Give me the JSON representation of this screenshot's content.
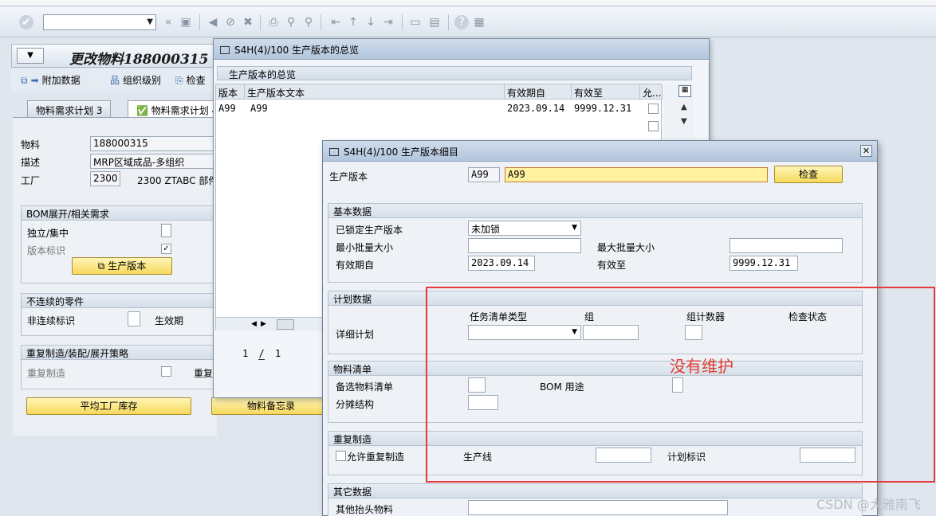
{
  "toolbar": {
    "command_field": "",
    "icons": [
      "enter-icon",
      "back-icon",
      "exit-icon",
      "cancel-icon",
      "save-icon",
      "print-icon",
      "find-icon",
      "find-next-icon",
      "first-page-icon",
      "prev-page-icon",
      "next-page-icon",
      "last-page-icon",
      "new-session-icon",
      "shortcut-icon",
      "help-icon",
      "layout-icon"
    ]
  },
  "main": {
    "title": "更改物料188000315",
    "app_toolbar": {
      "additional_data": "附加数据",
      "org_levels": "组织级别",
      "check": "检查"
    },
    "tabs": [
      {
        "label": "物料需求计划 3"
      },
      {
        "label": "物料需求计划 4"
      }
    ],
    "fields": {
      "material_label": "物料",
      "material_value": "188000315",
      "desc_label": "描述",
      "desc_value": "MRP区域成品-多组织",
      "plant_label": "工厂",
      "plant_value": "2300",
      "plant_text": "2300 ZTABC 部件"
    },
    "bom_group": {
      "title": "BOM展开/相关需求",
      "indiv_coll": "独立/集中",
      "version_ind": "版本标识",
      "prod_version_btn": "生产版本"
    },
    "discont_group": {
      "title": "不连续的零件",
      "discont_ind": "非连续标识",
      "effective_label": "生效期"
    },
    "rep_group": {
      "title": "重复制造/装配/展开策略",
      "rep_mfg": "重复制造",
      "rep_profile_short": "重复"
    },
    "bottom_buttons": {
      "avg_plant_stock": "平均工厂库存",
      "material_memo": "物料备忘录"
    }
  },
  "overview": {
    "title": "S4H(4)/100 生产版本的总览",
    "section": "生产版本的总览",
    "columns": [
      "版本",
      "生产版本文本",
      "有效期自",
      "有效至",
      "允..."
    ],
    "rows": [
      {
        "version": "A99",
        "text": "A99",
        "valid_from": "2023.09.14",
        "valid_to": "9999.12.31"
      }
    ],
    "pagination": {
      "current": "1",
      "sep": "/",
      "total": "1"
    }
  },
  "detail": {
    "title": "S4H(4)/100 生产版本细目",
    "prod_version_label": "生产版本",
    "prod_version_code": "A99",
    "prod_version_text": "A99",
    "check_btn": "检查",
    "basic": {
      "title": "基本数据",
      "locked_label": "已锁定生产版本",
      "locked_value": "未加锁",
      "min_lot_label": "最小批量大小",
      "min_lot_value": "",
      "max_lot_label": "最大批量大小",
      "max_lot_value": "",
      "valid_from_label": "有效期自",
      "valid_from_value": "2023.09.14",
      "valid_to_label": "有效至",
      "valid_to_value": "9999.12.31"
    },
    "planning": {
      "title": "计划数据",
      "col_task_list_type": "任务清单类型",
      "col_group": "组",
      "col_group_counter": "组计数器",
      "col_check_status": "检查状态",
      "detail_plan_label": "详细计划"
    },
    "bom": {
      "title": "物料清单",
      "alt_bom_label": "备选物料清单",
      "bom_usage_label": "BOM 用途",
      "apportion_label": "分摊结构"
    },
    "rep_mfg": {
      "title": "重复制造",
      "allow_label": "允许重复制造",
      "prod_line_label": "生产线",
      "plan_id_label": "计划标识"
    },
    "other": {
      "title": "其它数据",
      "other_header_mat_label": "其他抬头物料"
    }
  },
  "annotation": {
    "text": "没有维护"
  },
  "watermark": "CSDN @大雅南飞",
  "colors": {
    "highlight_red": "#e53a3a",
    "sap_yellow": "#f6d95d",
    "input_focus": "#fff1a0"
  }
}
